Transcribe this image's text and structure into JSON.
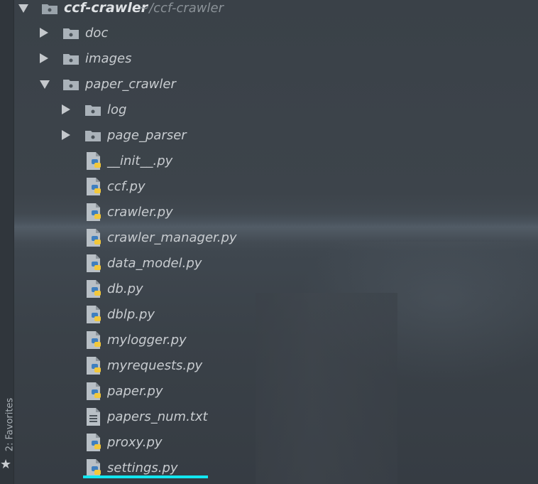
{
  "sidebar": {
    "favorites_label": "2: Favorites",
    "favorites_icon": "star-icon"
  },
  "project": {
    "name": "ccf-crawler",
    "path": "~/ccf-crawler"
  },
  "tree": {
    "doc": "doc",
    "images": "images",
    "paper_crawler": "paper_crawler",
    "log": "log",
    "page_parser": "page_parser",
    "files": [
      "__init__.py",
      "ccf.py",
      "crawler.py",
      "crawler_manager.py",
      "data_model.py",
      "db.py",
      "dblp.py",
      "mylogger.py",
      "myrequests.py",
      "paper.py",
      "papers_num.txt",
      "proxy.py",
      "settings.py"
    ]
  },
  "colors": {
    "text": "#c8ccd0",
    "python_blue": "#3f7fbf",
    "python_yellow": "#f2c83c",
    "cursor": "#12e6f0"
  }
}
